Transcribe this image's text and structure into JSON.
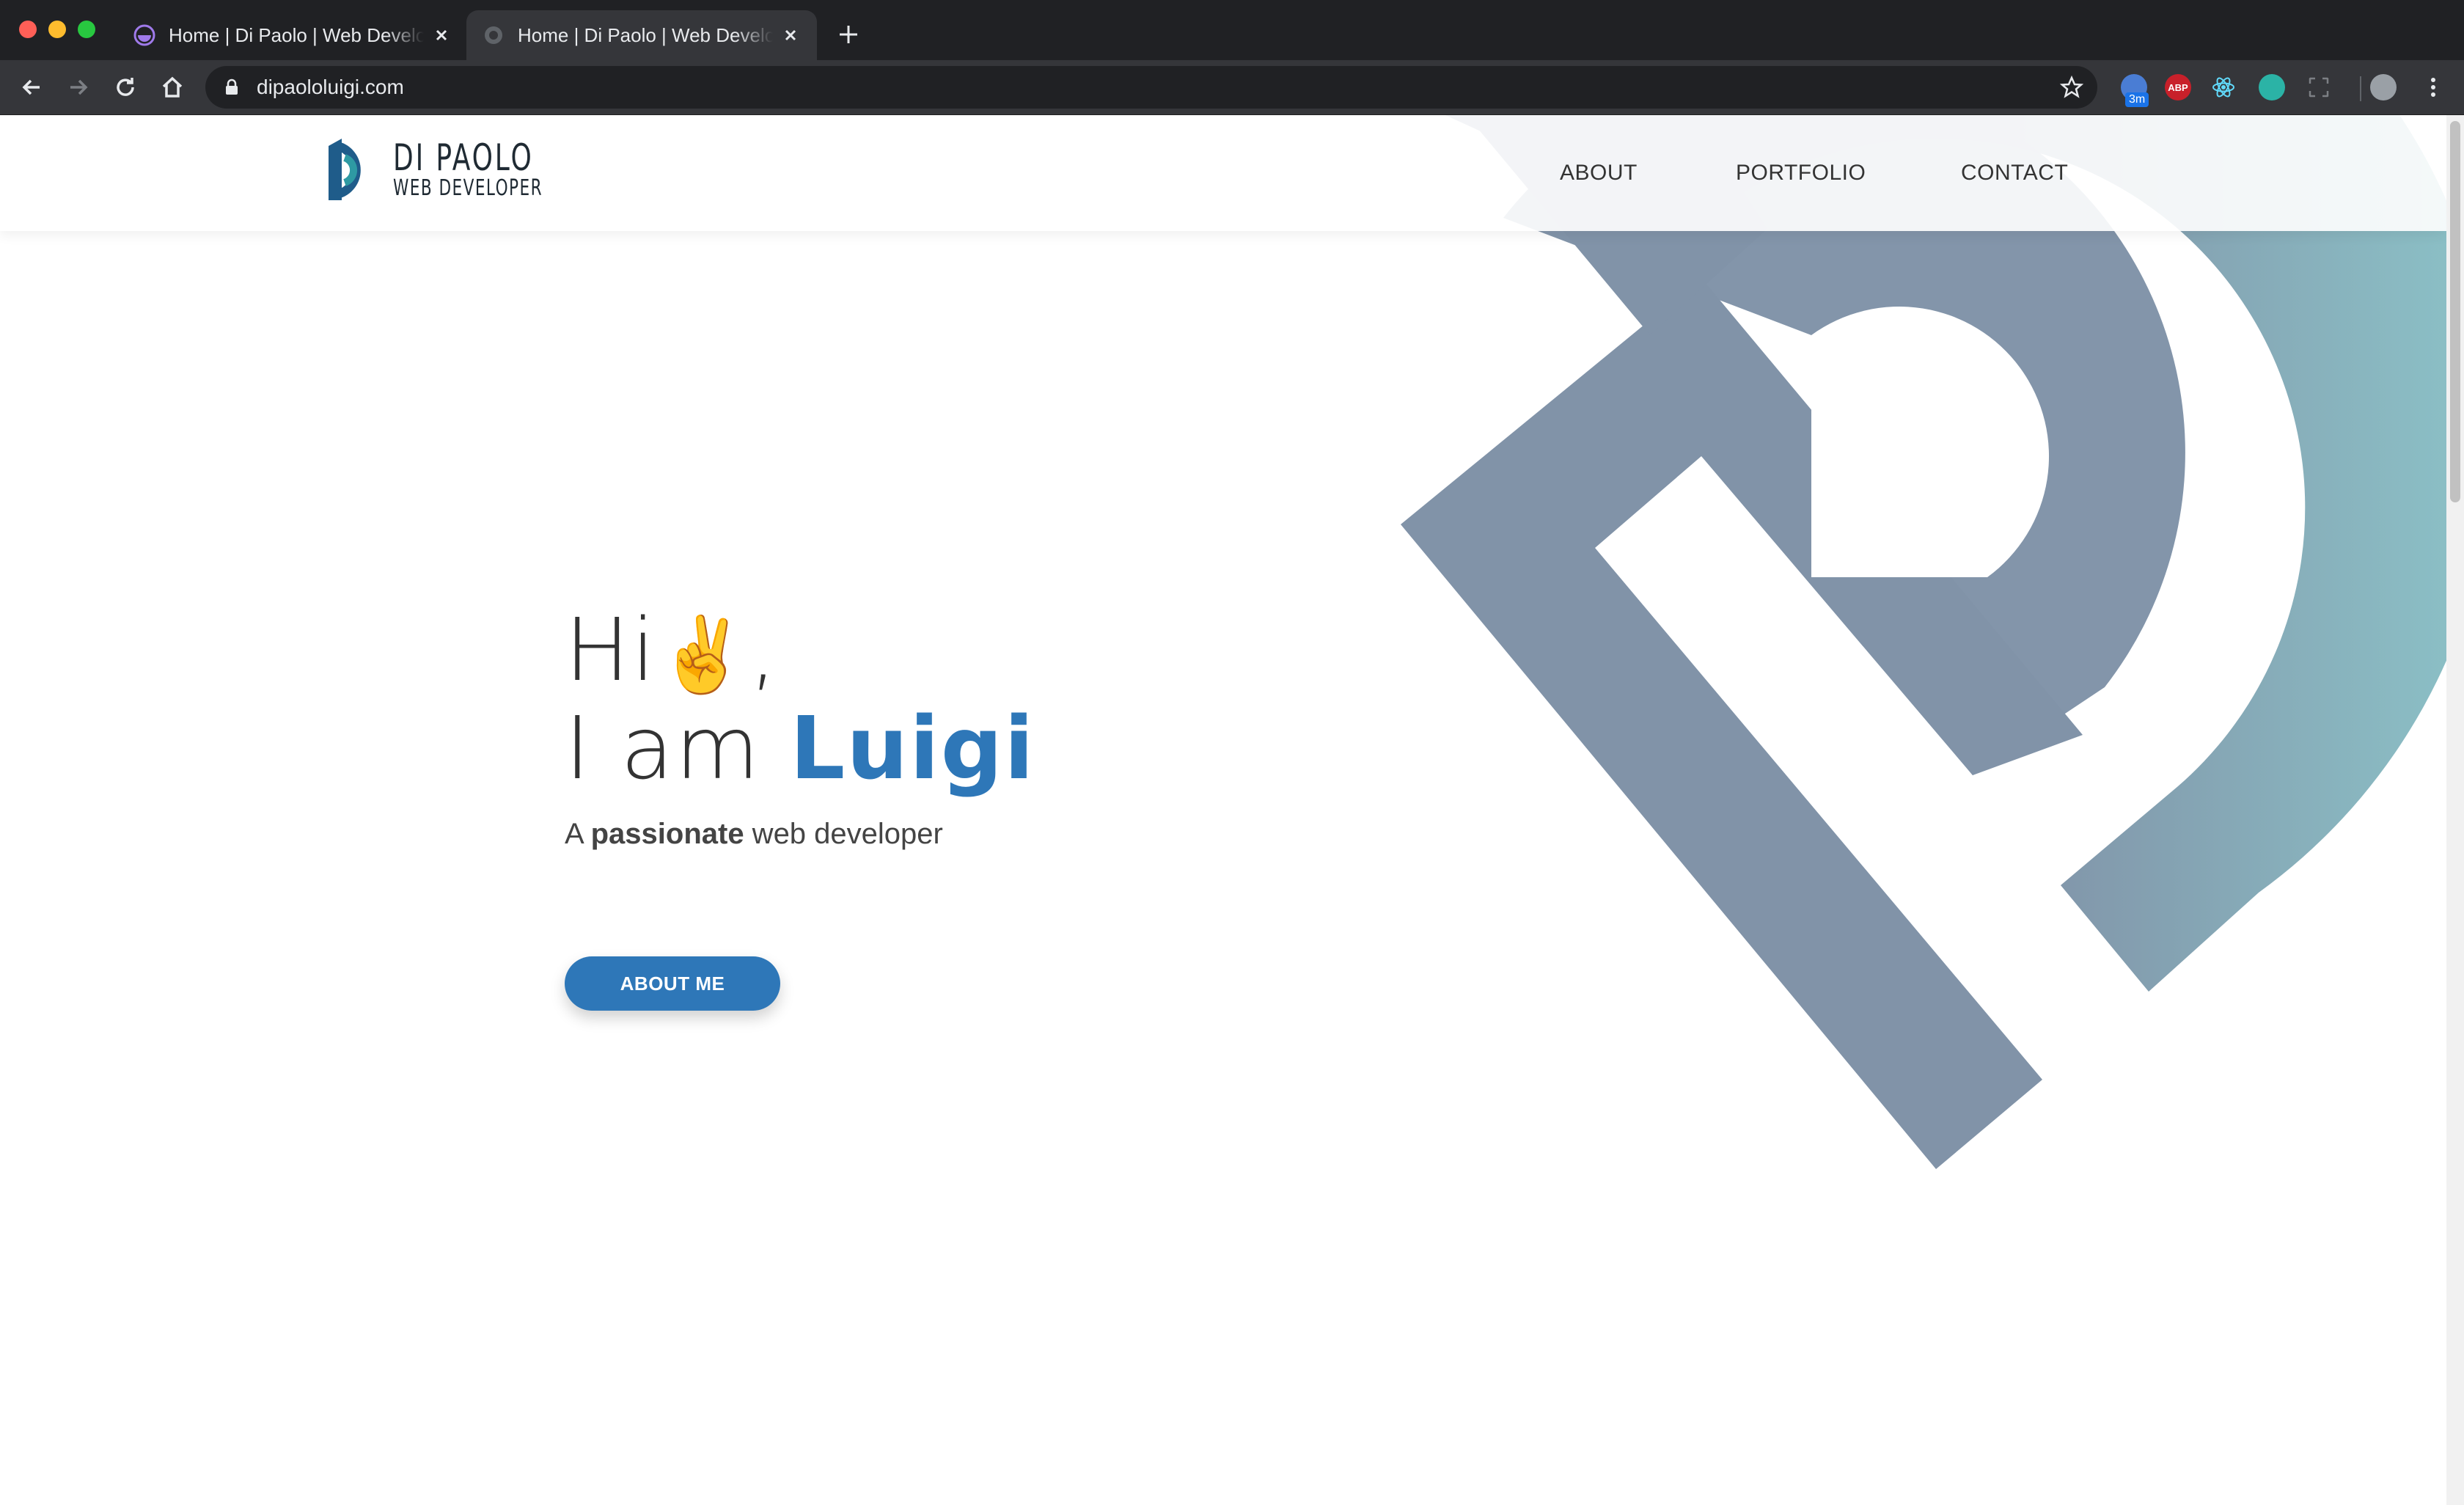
{
  "browser": {
    "tabs": [
      {
        "title": "Home | Di Paolo | Web Developer",
        "active": false
      },
      {
        "title": "Home | Di Paolo | Web Developer",
        "active": true
      }
    ],
    "url": "dipaololuigi.com",
    "extension_badge": "3m",
    "extension_abp": "ABP"
  },
  "site": {
    "brand_name": "DI PAOLO",
    "brand_tagline": "WEB DEVELOPER",
    "nav": [
      "ABOUT",
      "PORTFOLIO",
      "CONTACT"
    ]
  },
  "hero": {
    "greeting": "Hi",
    "emoji": "✌️",
    "comma": ",",
    "intro": "I am ",
    "name": "Luigi",
    "sub_prefix": "A ",
    "sub_bold": "passionate",
    "sub_suffix": " web developer",
    "cta_label": "ABOUT ME"
  },
  "colors": {
    "accent": "#2e77b8",
    "logo_slate": "#8193a8",
    "logo_teal": "#8cc3c8"
  }
}
